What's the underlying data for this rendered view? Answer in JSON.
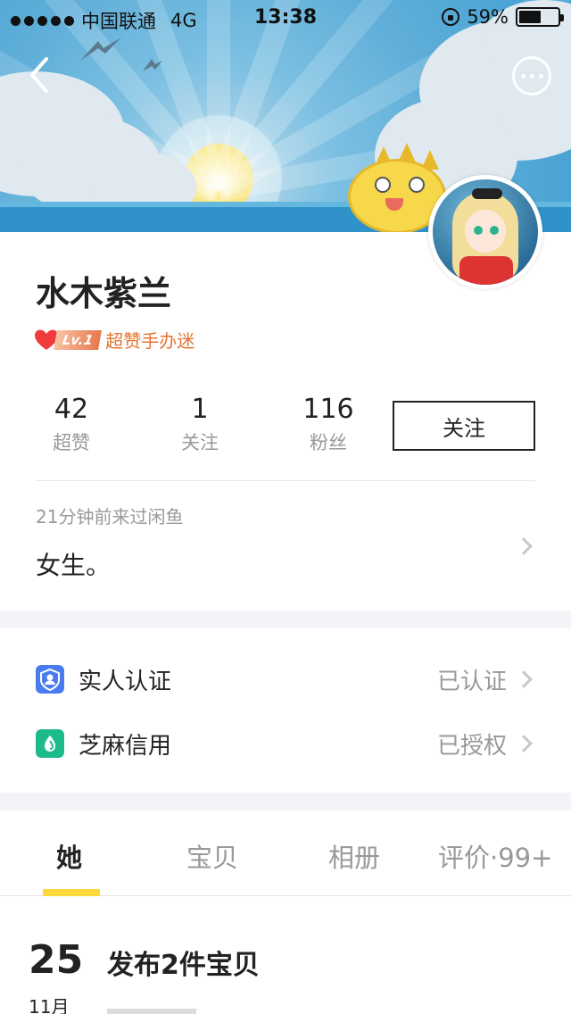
{
  "status_bar": {
    "carrier": "中国联通",
    "network": "4G",
    "time": "13:38",
    "battery": "59%"
  },
  "header": {
    "back_icon": "chevron-left-icon",
    "more_icon": "ellipsis-circle-icon"
  },
  "profile": {
    "name": "水木紫兰",
    "level_tag": "Lv.1",
    "badge_text": "超赞手办迷",
    "stats": [
      {
        "value": "42",
        "label": "超赞"
      },
      {
        "value": "1",
        "label": "关注"
      },
      {
        "value": "116",
        "label": "粉丝"
      }
    ],
    "follow_label": "关注",
    "last_seen": "21分钟前来过闲鱼",
    "bio": "女生。"
  },
  "verifications": [
    {
      "label": "实人认证",
      "value": "已认证",
      "icon": "person-shield-icon",
      "color": "#4a7cf0"
    },
    {
      "label": "芝麻信用",
      "value": "已授权",
      "icon": "sesame-drop-icon",
      "color": "#1dbb8c"
    }
  ],
  "tabs": [
    {
      "label": "她",
      "active": true
    },
    {
      "label": "宝贝",
      "active": false
    },
    {
      "label": "相册",
      "active": false
    },
    {
      "label": "评价·99+",
      "active": false
    }
  ],
  "feed": {
    "day": "25",
    "month": "11月",
    "title": "发布2件宝贝"
  },
  "colors": {
    "accent": "#ffd93a",
    "badge_orange": "#e4732f",
    "muted": "#999999"
  }
}
